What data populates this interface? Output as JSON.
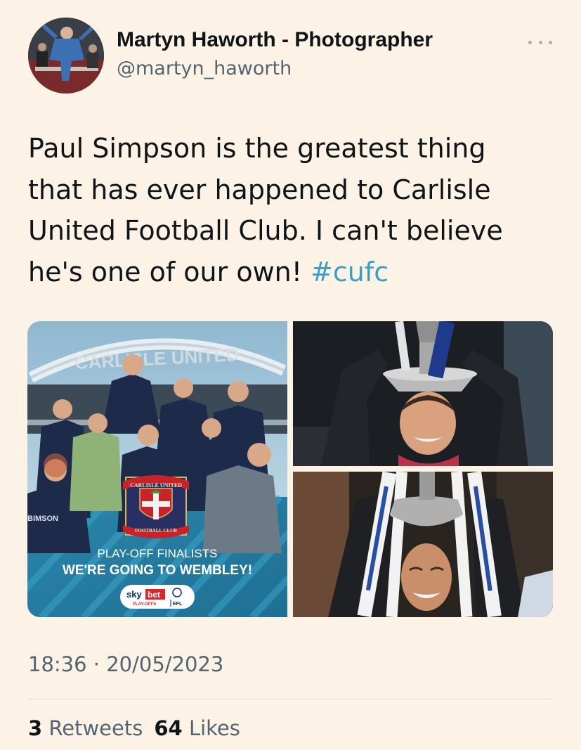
{
  "author": {
    "display_name": "Martyn Haworth - Photographer",
    "handle": "@martyn_haworth",
    "avatar_icon": "profile-photo"
  },
  "more_icon": "ellipsis-icon",
  "tweet": {
    "lines": [
      "Paul Simpson is the greatest thing",
      "that has ever happened to Carlisle",
      "United Football Club. I can't believe",
      "he's one of our own! "
    ],
    "hashtag": "#cufc"
  },
  "media": {
    "graphic": {
      "arch_text": "CARLISLE UNITED",
      "sponsor_text": "BIMSON",
      "crest_top": "CARLISLE UNITED",
      "crest_bottom": "FOOTBALL CLUB",
      "headline": "PLAY-OFF FINALISTS",
      "subheadline": "WE'RE GOING TO WEMBLEY!",
      "badge_brand": "sky",
      "badge_bet": "bet",
      "badge_sub": "PLAY-OFFS",
      "badge_efl": "EFL"
    }
  },
  "timestamp": "18:36 · 20/05/2023",
  "stats": {
    "retweets_count": "3",
    "retweets_label": "Retweets",
    "likes_count": "64",
    "likes_label": "Likes"
  },
  "colors": {
    "background": "#fcf3e6",
    "hashtag": "#3d9ec4",
    "muted": "#536471",
    "graphic_blue": "#2f8fb0"
  }
}
